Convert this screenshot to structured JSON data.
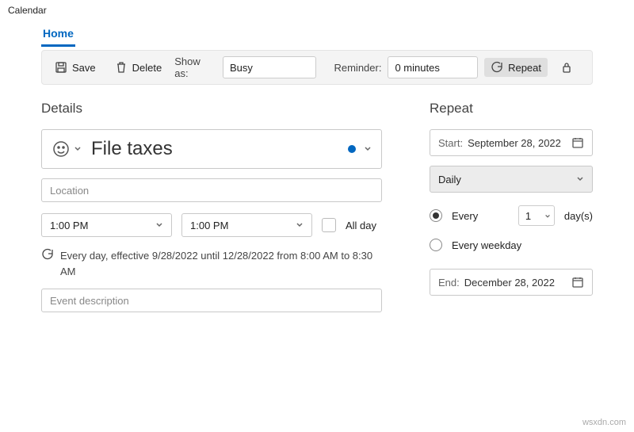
{
  "window": {
    "title": "Calendar"
  },
  "tabs": {
    "home": "Home"
  },
  "toolbar": {
    "save": "Save",
    "delete": "Delete",
    "showas_label": "Show as:",
    "showas_value": "Busy",
    "reminder_label": "Reminder:",
    "reminder_value": "0 minutes",
    "repeat": "Repeat"
  },
  "details": {
    "heading": "Details",
    "title": "File taxes",
    "location_placeholder": "Location",
    "start_time": "1:00 PM",
    "end_time": "1:00 PM",
    "all_day": "All day",
    "recurrence_text": "Every day, effective 9/28/2022 until 12/28/2022 from 8:00 AM to 8:30 AM",
    "description_placeholder": "Event description"
  },
  "repeat": {
    "heading": "Repeat",
    "start_label": "Start:",
    "start_value": "September 28, 2022",
    "frequency": "Daily",
    "every_label": "Every",
    "every_value": "1",
    "every_unit": "day(s)",
    "weekday_label": "Every weekday",
    "end_label": "End:",
    "end_value": "December 28, 2022"
  },
  "footer": {
    "watermark": "wsxdn.com"
  }
}
